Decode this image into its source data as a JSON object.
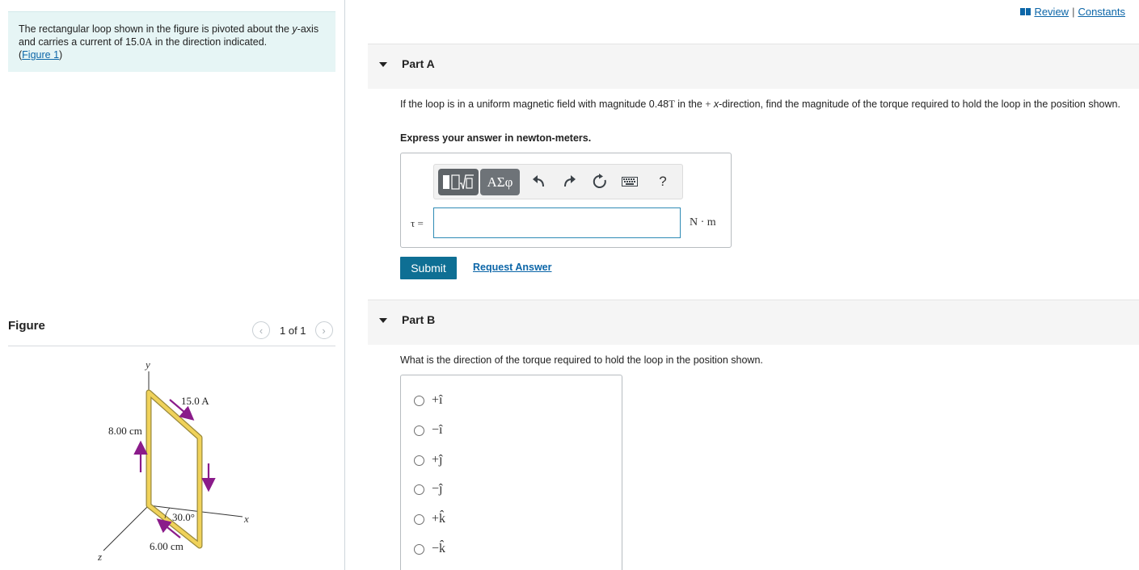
{
  "problem": {
    "text_part1": "The rectangular loop shown in the figure is pivoted about the ",
    "y_var": "y",
    "text_part2": "-axis and carries a current of 15.0",
    "amp_unit": "A",
    "text_part3": " in the direction indicated.",
    "figure_link_open": "(",
    "figure_link": "Figure 1",
    "figure_link_close": ")"
  },
  "figure": {
    "title": "Figure",
    "pager_text": "1 of 1",
    "prev_icon": "chevron-left-icon",
    "next_icon": "chevron-right-icon",
    "labels": {
      "y_axis": "y",
      "x_axis": "x",
      "z_axis": "z",
      "current": "15.0 A",
      "height": "8.00 cm",
      "width": "6.00 cm",
      "angle": "30.0°"
    },
    "colors": {
      "loop_fill": "#f0d25a",
      "loop_edge": "#9a8a3c",
      "arrow": "#8a1b8a"
    }
  },
  "header": {
    "review_icon": "book-icon",
    "review": "Review",
    "separator": "|",
    "constants": "Constants"
  },
  "partA": {
    "label": "Part A",
    "question_p1": "If the loop is in a uniform magnetic field with magnitude 0.48",
    "tesla": "T",
    "question_p2": " in the ",
    "plus": "+",
    "x_var": " x",
    "question_p3": "-direction, find the magnitude of the torque required to hold the loop in the position shown.",
    "instruction": "Express your answer in newton-meters.",
    "toolbar": {
      "templates_icon": "templates-icon",
      "greek": "ΑΣφ",
      "undo_icon": "undo-icon",
      "redo_icon": "redo-icon",
      "reset_icon": "reset-icon",
      "keyboard_icon": "keyboard-icon",
      "help": "?"
    },
    "input_label": "τ =",
    "input_value": "",
    "unit": "N · m",
    "submit": "Submit",
    "request_answer": "Request Answer"
  },
  "partB": {
    "label": "Part B",
    "question": "What is the direction of the torque required to hold the loop in the position shown.",
    "choices": [
      "+î",
      "−î",
      "+ĵ",
      "−ĵ",
      "+k̂",
      "−k̂"
    ]
  }
}
